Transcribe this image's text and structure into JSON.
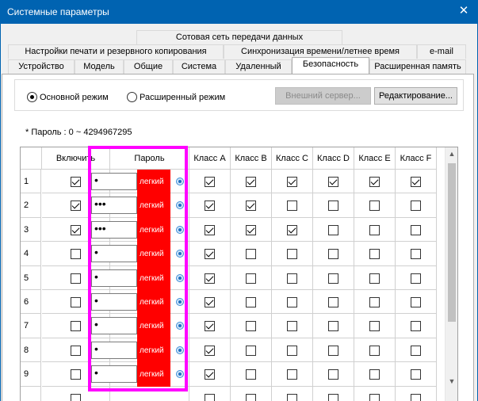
{
  "titlebar": {
    "title": "Системные параметры",
    "close_glyph": "✕"
  },
  "tabs": {
    "row1": [
      "Сотовая сеть передачи данных"
    ],
    "row2": [
      "Настройки печати и резервного копирования",
      "Синхронизация времени/летнее время",
      "e-mail"
    ],
    "row3": [
      "Устройство",
      "Модель",
      "Общие",
      "Система",
      "Удаленный",
      "Безопасность",
      "Расширенная память"
    ],
    "active": "Безопасность"
  },
  "mode": {
    "basic_label": "Основной режим",
    "advanced_label": "Расширенный режим",
    "selected": "basic",
    "external_server_label": "Внешний сервер...",
    "edit_label": "Редактирование..."
  },
  "password_note": "* Пароль : 0 ~ 4294967295",
  "table": {
    "headers": [
      "Включить",
      "Пароль",
      "Класс A",
      "Класс B",
      "Класс C",
      "Класс D",
      "Класс E",
      "Класс F"
    ],
    "rows": [
      {
        "num": "1",
        "enabled": true,
        "password": "•",
        "strength": "легкий",
        "classes": [
          true,
          true,
          true,
          true,
          true,
          true
        ]
      },
      {
        "num": "2",
        "enabled": true,
        "password": "•••",
        "strength": "легкий",
        "classes": [
          true,
          true,
          false,
          false,
          false,
          false
        ]
      },
      {
        "num": "3",
        "enabled": true,
        "password": "•••",
        "strength": "легкий",
        "classes": [
          true,
          true,
          true,
          false,
          false,
          false
        ]
      },
      {
        "num": "4",
        "enabled": false,
        "password": "•",
        "strength": "легкий",
        "classes": [
          true,
          false,
          false,
          false,
          false,
          false
        ]
      },
      {
        "num": "5",
        "enabled": false,
        "password": "•",
        "strength": "легкий",
        "classes": [
          true,
          false,
          false,
          false,
          false,
          false
        ]
      },
      {
        "num": "6",
        "enabled": false,
        "password": "•",
        "strength": "легкий",
        "classes": [
          true,
          false,
          false,
          false,
          false,
          false
        ]
      },
      {
        "num": "7",
        "enabled": false,
        "password": "•",
        "strength": "легкий",
        "classes": [
          true,
          false,
          false,
          false,
          false,
          false
        ]
      },
      {
        "num": "8",
        "enabled": false,
        "password": "•",
        "strength": "легкий",
        "classes": [
          true,
          false,
          false,
          false,
          false,
          false
        ]
      },
      {
        "num": "9",
        "enabled": false,
        "password": "•",
        "strength": "легкий",
        "classes": [
          true,
          false,
          false,
          false,
          false,
          false
        ]
      },
      {
        "num": "",
        "enabled": false,
        "password": "",
        "strength": "",
        "classes": [
          false,
          false,
          false,
          false,
          false,
          false
        ]
      }
    ]
  },
  "icons": {
    "close": "close-icon",
    "show_password": "eye-icon",
    "scroll_up": "chevron-up-icon",
    "scroll_down": "chevron-down-icon"
  },
  "colors": {
    "titlebar": "#0063b1",
    "strength_weak": "#ff0000",
    "highlight": "#ff00ff"
  }
}
